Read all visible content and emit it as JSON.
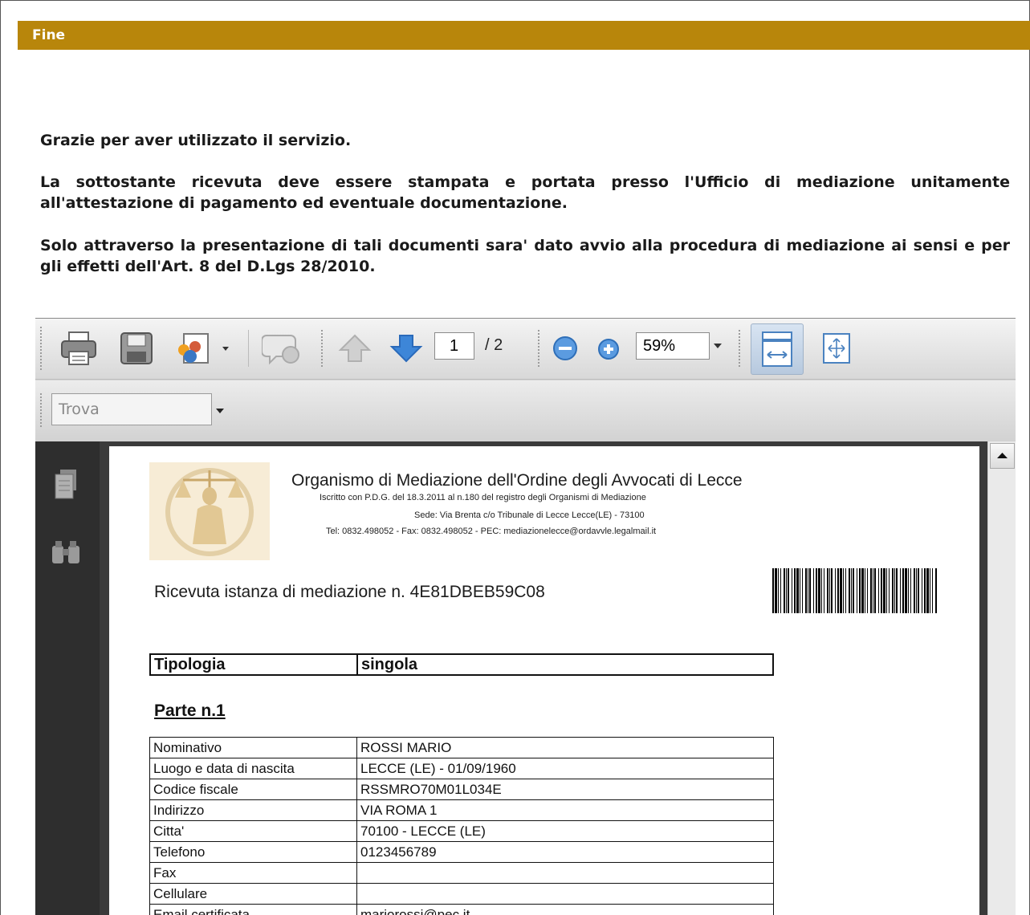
{
  "header": {
    "title": "Fine"
  },
  "messages": {
    "thanks": "Grazie per aver utilizzato il servizio.",
    "print_notice": "La sottostante ricevuta deve essere stampata e portata presso l'Ufficio di mediazione unitamente all'attestazione di pagamento ed eventuale documentazione.",
    "procedure_notice": "Solo attraverso la presentazione di tali documenti sara' dato avvio alla procedura di mediazione ai sensi e per gli effetti dell'Art. 8 del D.Lgs 28/2010."
  },
  "pdf_viewer": {
    "toolbar": {
      "icons": [
        "print-icon",
        "save-icon",
        "share-icon",
        "comment-icon",
        "page-up-icon",
        "page-down-icon",
        "zoom-out-icon",
        "zoom-in-icon",
        "fit-width-icon",
        "fit-page-icon"
      ],
      "current_page": "1",
      "total_pages": "/ 2",
      "zoom": "59%"
    },
    "find": {
      "placeholder": "Trova"
    },
    "sidebar_icons": [
      "pages-icon",
      "binoculars-icon"
    ],
    "document": {
      "org_title": "Organismo di Mediazione dell'Ordine degli Avvocati di Lecce",
      "org_registry": "Iscritto con P.D.G. del 18.3.2011 al n.180 del registro degli Organismi di Mediazione",
      "org_address": "Sede: Via Brenta c/o Tribunale di Lecce Lecce(LE) - 73100",
      "org_contacts": "Tel: 0832.498052 - Fax: 0832.498052 - PEC: mediazionelecce@ordavvle.legalmail.it",
      "receipt_title": "Ricevuta istanza di mediazione n. 4E81DBEB59C08",
      "tipologia_label": "Tipologia",
      "tipologia_value": "singola",
      "parte_heading": "Parte n.1",
      "parte_rows": [
        {
          "label": "Nominativo",
          "value": "ROSSI MARIO"
        },
        {
          "label": "Luogo e data di nascita",
          "value": "LECCE (LE) - 01/09/1960"
        },
        {
          "label": "Codice fiscale",
          "value": "RSSMRO70M01L034E"
        },
        {
          "label": "Indirizzo",
          "value": "VIA ROMA 1"
        },
        {
          "label": "Citta'",
          "value": "70100 - LECCE (LE)"
        },
        {
          "label": "Telefono",
          "value": "0123456789"
        },
        {
          "label": "Fax",
          "value": ""
        },
        {
          "label": "Cellulare",
          "value": ""
        },
        {
          "label": "Email certificata",
          "value": "mariorossi@pec.it"
        }
      ]
    }
  }
}
